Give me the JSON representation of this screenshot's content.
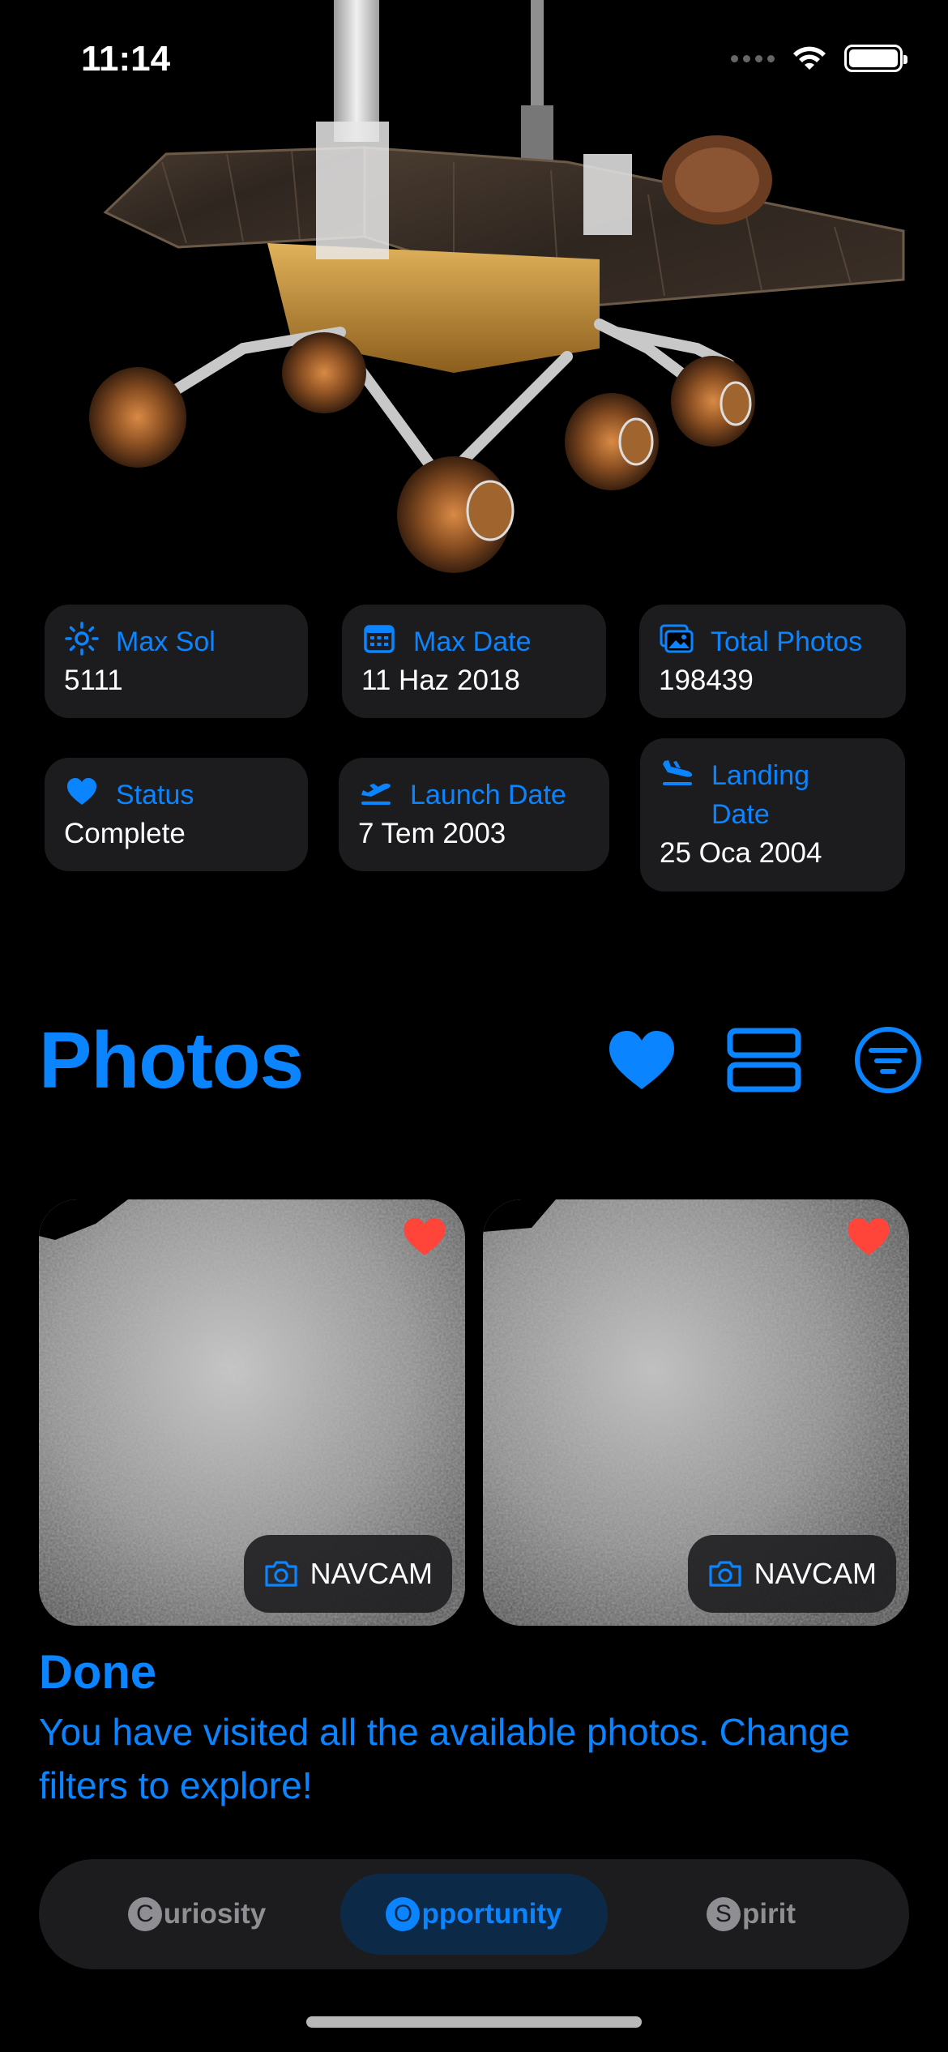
{
  "status_bar": {
    "time": "11:14"
  },
  "rover_image": {
    "alt": "rover"
  },
  "stats": [
    {
      "icon": "sun-icon",
      "label": "Max Sol",
      "value": "5111"
    },
    {
      "icon": "calendar-icon",
      "label": "Max Date",
      "value": "11 Haz 2018"
    },
    {
      "icon": "photos-icon",
      "label": "Total Photos",
      "value": "198439"
    },
    {
      "icon": "heart-icon",
      "label": "Status",
      "value": "Complete"
    },
    {
      "icon": "takeoff-icon",
      "label": "Launch Date",
      "value": "7 Tem 2003"
    },
    {
      "icon": "landing-icon",
      "label": "Landing Date",
      "value": "25 Oca 2004"
    }
  ],
  "photos": {
    "title": "Photos",
    "header_icons": [
      "heart-icon",
      "list-layout-icon",
      "filter-icon"
    ],
    "items": [
      {
        "camera": "NAVCAM",
        "favorite": true
      },
      {
        "camera": "NAVCAM",
        "favorite": true
      }
    ]
  },
  "done": {
    "title": "Done",
    "message": "You have visited all the available photos. Change filters to explore!"
  },
  "rovers": {
    "selected": "Opportunity",
    "items": [
      {
        "initial": "C",
        "rest": "uriosity"
      },
      {
        "initial": "O",
        "rest": "pportunity"
      },
      {
        "initial": "S",
        "rest": "pirit"
      }
    ]
  },
  "colors": {
    "accent": "#0a84ff",
    "card": "#1c1c1e",
    "favorite": "#ff453a",
    "background": "#000000"
  }
}
